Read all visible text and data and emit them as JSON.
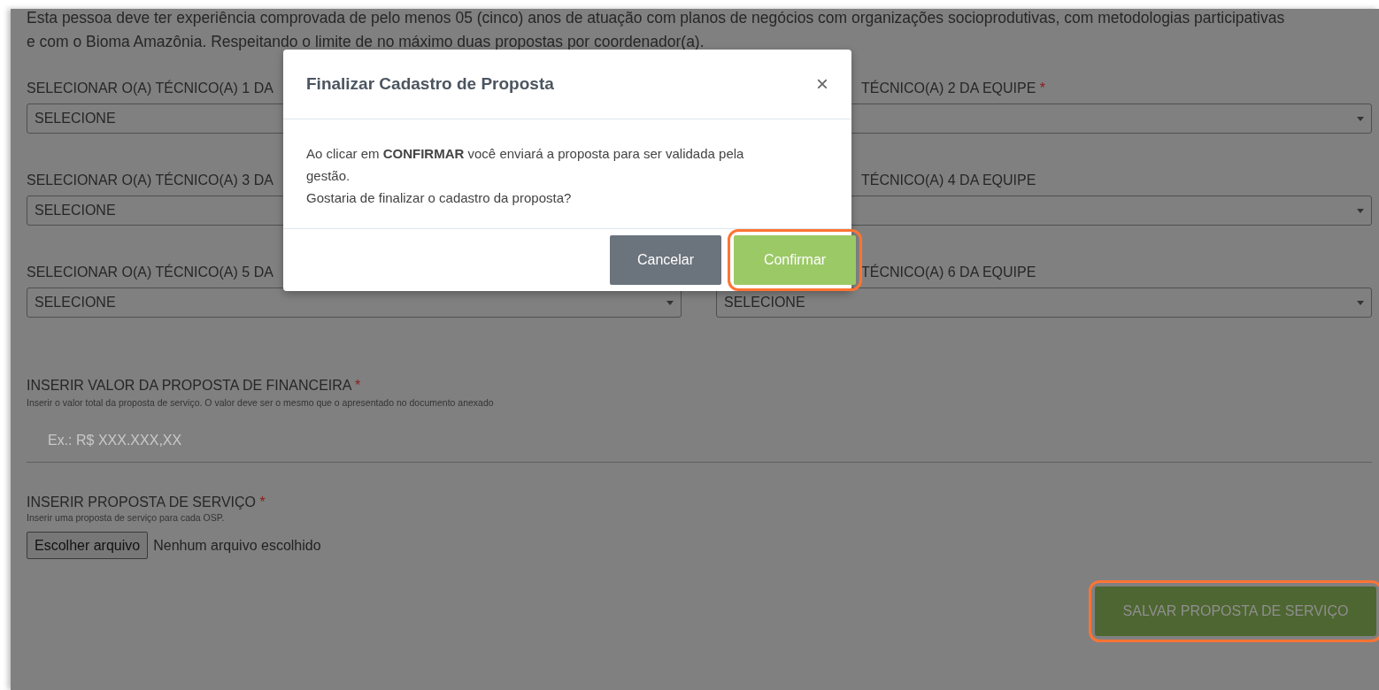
{
  "intro": "Esta pessoa deve ter experiência comprovada de pelo menos 05 (cinco) anos de atuação com planos de negócios com organizações socioprodutivas, com metodologias participativas e com o Bioma Amazônia. Respeitando o limite de no máximo duas propostas por coordenador(a).",
  "technician_rows": [
    {
      "left": {
        "label": "SELECIONAR O(A) TÉCNICO(A) 1 DA",
        "value": "SELECIONE"
      },
      "right": {
        "label": "TÉCNICO(A) 2 DA EQUIPE",
        "required_mark": "*",
        "caret": true
      }
    },
    {
      "left": {
        "label": "SELECIONAR O(A) TÉCNICO(A) 3 DA",
        "value": "SELECIONE"
      },
      "right": {
        "label": "TÉCNICO(A) 4 DA EQUIPE",
        "caret": true
      }
    },
    {
      "left": {
        "label": "SELECIONAR O(A) TÉCNICO(A) 5 DA",
        "value": "SELECIONE",
        "caret": true
      },
      "right": {
        "label": "TÉCNICO(A) 6 DA EQUIPE",
        "value": "SELECIONE",
        "caret": true
      }
    }
  ],
  "value_field": {
    "label": "INSERIR VALOR DA PROPOSTA DE FINANCEIRA",
    "required_mark": "*",
    "hint": "Inserir o valor total da proposta de serviço. O valor deve ser o mesmo que o apresentado no documento anexado",
    "placeholder": "Ex.: R$ XXX.XXX,XX"
  },
  "file_field": {
    "label": "INSERIR PROPOSTA DE SERVIÇO",
    "required_mark": "*",
    "hint": "Inserir uma proposta de serviço para cada OSP.",
    "button": "Escolher arquivo",
    "status": "Nenhum arquivo escolhido"
  },
  "save_button": {
    "label": "SALVAR PROPOSTA DE SERVIÇO",
    "highlighted": true
  },
  "modal": {
    "title": "Finalizar Cadastro de Proposta",
    "close": "×",
    "body": [
      "Ao clicar em **CONFIRMAR** você enviará a proposta para ser validada pela gestão.",
      "Gostaria de finalizar o cadastro da proposta?"
    ],
    "buttons": [
      {
        "label": "Cancelar",
        "kind": "secondary",
        "highlighted": false
      },
      {
        "label": "Confirmar",
        "kind": "primary",
        "highlighted": true
      }
    ]
  }
}
